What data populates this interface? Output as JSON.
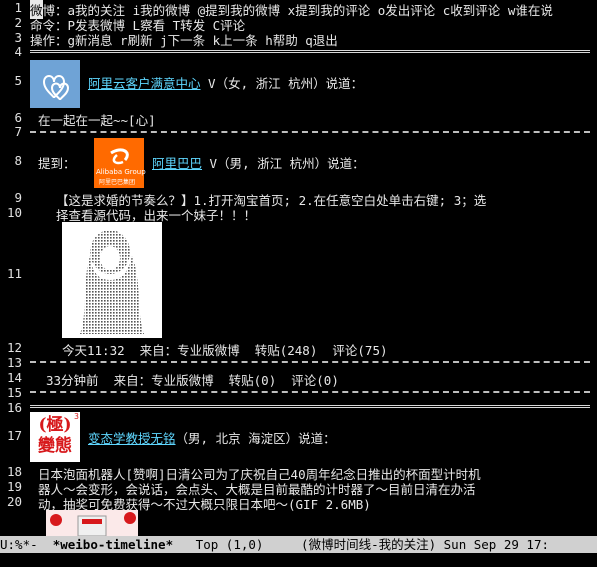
{
  "header": {
    "l1_prefix": "微",
    "l1_rest": "博：a我的关注 i我的微博 @提到我的微博 x提到我的评论 o发出评论 c收到评论 w谁在说",
    "l2": "命令：P发表微博 L察看 T转发 C评论",
    "l3": "操作：g新消息 r刷新 j下一条 k上一条 h帮助 q退出"
  },
  "line_numbers": [
    "1",
    "2",
    "3",
    "4",
    "5",
    "6",
    "7",
    "8",
    "9",
    "10",
    "11",
    "12",
    "13",
    "14",
    "15",
    "16",
    "17",
    "18",
    "19",
    "20"
  ],
  "post1": {
    "author": "阿里云客户满意中心",
    "meta": " V（女, 浙江 杭州）说道：",
    "text": "在一起在一起~~[心]"
  },
  "post2": {
    "prefix": "提到：",
    "author": "阿里巴巴",
    "meta": " V（男, 浙江 杭州）说道：",
    "text1": "【这是求婚的节奏么？】1.打开淘宝首页; 2.在任意空白处单击右键; 3；选",
    "text2": "择查看源代码，出来一个妹子！！！",
    "footer": "今天11:32  来自：专业版微博  转贴(248)  评论(75)",
    "logo_text": "Alibaba Group",
    "logo_sub": "阿里巴巴集团"
  },
  "post1_footer": "33分钟前  来自：专业版微博  转贴(0)  评论(0)",
  "post3": {
    "author": "变态学教授无铭",
    "meta": "（男, 北京 海淀区）说道：",
    "text1": "日本泡面机器人[赞啊]日清公司为了庆祝自己40周年纪念日推出的杯面型计时机",
    "text2": "器人～会变形，会说话，会点头、大概是目前最酷的计时器了～目前日清在办活",
    "text3": "动，抽奖可免费获得～不过大概只限日本吧～(GIF 2.6MB)",
    "avatar_text": "(極)\n變態",
    "avatar_badge": "3"
  },
  "modeline": {
    "left": "U:%*-  ",
    "buffer": "*weibo-timeline*",
    "pos": "   Top (1,0)     ",
    "mode": "(微博时间线-我的关注)",
    "date": " Sun Sep 29 17:"
  },
  "colors": {
    "link": "#5fd7ff",
    "modeline_bg": "#d0d0d0",
    "alibaba_orange": "#ff6a00",
    "biantai_red": "#d7191c"
  }
}
